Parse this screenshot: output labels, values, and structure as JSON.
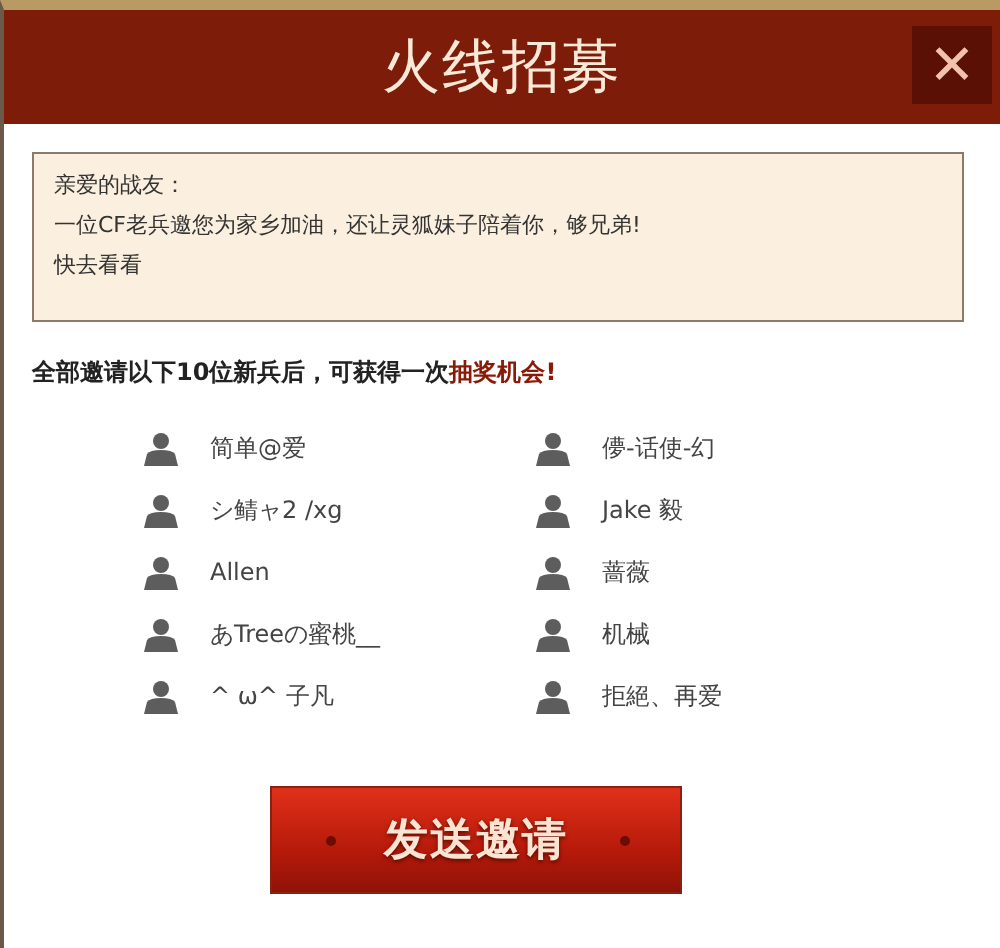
{
  "dialog": {
    "title": "火线招募",
    "close_label": "✕"
  },
  "message": {
    "lines": [
      "亲爱的战友：",
      "一位CF老兵邀您为家乡加油，还让灵狐妹子陪着你，够兄弟!",
      "快去看看"
    ]
  },
  "notice": {
    "text": "全部邀请以下10位新兵后，可获得一次",
    "highlight": "抽奖机会!"
  },
  "friends": [
    {
      "name": "简单@爱"
    },
    {
      "name": "儚-话使-幻"
    },
    {
      "name": "シ鲭ャ2 /xg"
    },
    {
      "name": "Jake 毅"
    },
    {
      "name": "Allen"
    },
    {
      "name": "蔷薇"
    },
    {
      "name": "あTreeの蜜桃__"
    },
    {
      "name": "机械"
    },
    {
      "name": "^ ω^ 子凡"
    },
    {
      "name": "拒絕、再爱"
    }
  ],
  "send_button": {
    "label": "发送邀请"
  }
}
